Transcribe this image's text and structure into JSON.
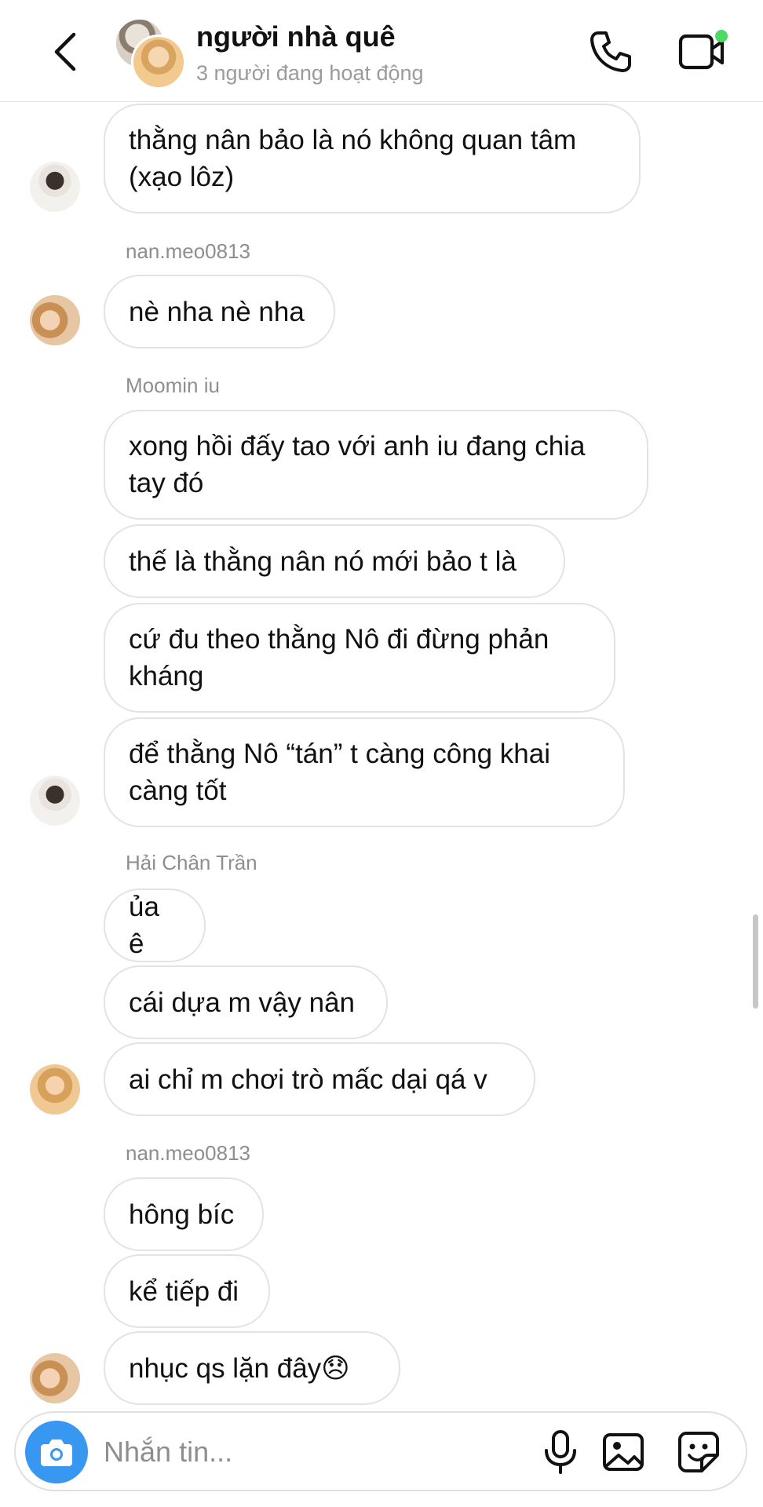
{
  "header": {
    "title": "người nhà quê",
    "subtitle": "3 người đang hoạt động",
    "online_color": "#4cd964"
  },
  "messages": [
    {
      "type": "bubble",
      "text": "thằng nân bảo là nó không quan tâm\n(xạo lôz)"
    },
    {
      "type": "sender",
      "text": "nan.meo0813"
    },
    {
      "type": "bubble",
      "text": "nè nha nè nha"
    },
    {
      "type": "sender",
      "text": "Moomin iu"
    },
    {
      "type": "bubble",
      "text": "xong hồi đấy tao với anh iu đang chia\ntay đó"
    },
    {
      "type": "bubble",
      "text": "thế là thằng nân nó mới bảo t là"
    },
    {
      "type": "bubble",
      "text": "cứ đu theo thằng Nô đi đừng phản\nkháng"
    },
    {
      "type": "bubble",
      "text": "để thằng Nô “tán” t càng công khai\ncàng tốt"
    },
    {
      "type": "sender",
      "text": "Hải Chân Trần"
    },
    {
      "type": "bubble",
      "text": "ủa ê"
    },
    {
      "type": "bubble",
      "text": "cái dựa m vậy nân"
    },
    {
      "type": "bubble",
      "text": "ai chỉ m chơi trò mấc dại qá v"
    },
    {
      "type": "sender",
      "text": "nan.meo0813"
    },
    {
      "type": "bubble",
      "text": "hông bíc"
    },
    {
      "type": "bubble",
      "text": "kể tiếp đi"
    },
    {
      "type": "bubble",
      "text": "nhục qs lặn đây😞"
    }
  ],
  "composer": {
    "placeholder": "Nhắn tin...",
    "camera_color": "#3897f0"
  },
  "icons": {
    "back": "chevron-left-icon",
    "call": "phone-icon",
    "video": "video-camera-icon",
    "camera": "camera-icon",
    "mic": "microphone-icon",
    "gallery": "image-icon",
    "sticker": "sticker-icon"
  }
}
